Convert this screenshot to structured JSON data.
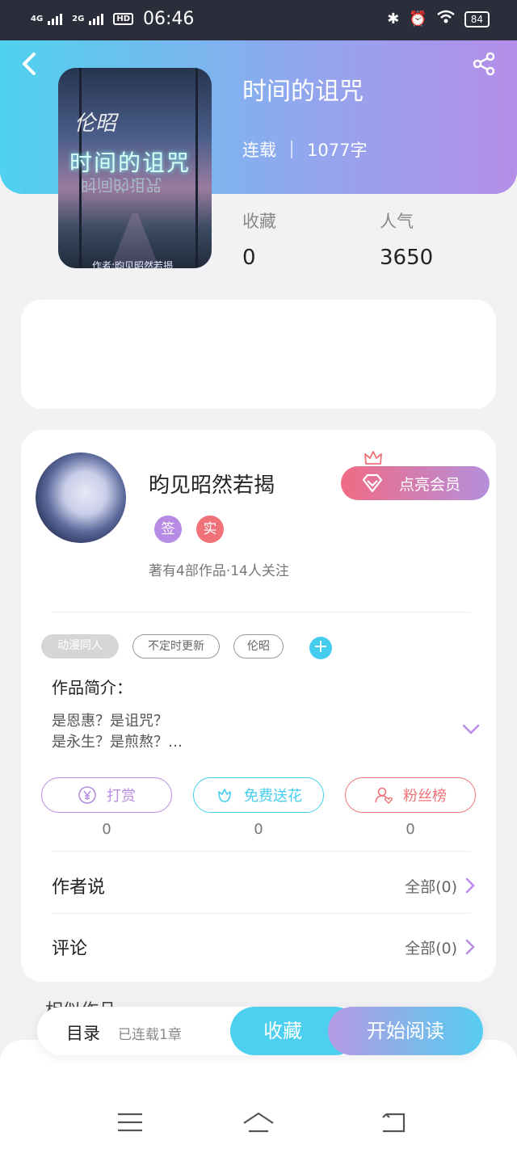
{
  "status_bar": {
    "net1": "4G",
    "net2": "2G",
    "hd": "HD",
    "time": "06:46",
    "battery": "84"
  },
  "book": {
    "title": "时间的诅咒",
    "status": "连载",
    "word_count": "1077字",
    "cover": {
      "top_text": "伦昭",
      "title_text": "时间的诅咒",
      "author_text": "作者:昀见昭然若揭"
    },
    "stats": [
      {
        "label": "收藏",
        "value": "0"
      },
      {
        "label": "人气",
        "value": "3650"
      }
    ]
  },
  "author": {
    "name": "昀见昭然若揭",
    "badges": [
      {
        "label": "签",
        "color": "#b78be3"
      },
      {
        "label": "实",
        "color": "#f07178"
      }
    ],
    "stats": "著有4部作品·14人关注",
    "vip_button": "点亮会员"
  },
  "tags": [
    "动漫同人",
    "不定时更新",
    "伦昭"
  ],
  "tag_add": "+",
  "intro": {
    "label": "作品简介：",
    "line1": "是恩惠？是诅咒？",
    "line2": "是永生？是煎熬？…"
  },
  "actions": [
    {
      "label": "打赏",
      "count": "0",
      "color": "#b78be3",
      "icon": "yen-coin-icon"
    },
    {
      "label": "免费送花",
      "count": "0",
      "color": "#45cdf0",
      "icon": "flower-icon"
    },
    {
      "label": "粉丝榜",
      "count": "0",
      "color": "#f07178",
      "icon": "fan-ranking-icon"
    }
  ],
  "sections": [
    {
      "label": "作者说",
      "link": "全部(0)"
    },
    {
      "label": "评论",
      "link": "全部(0)"
    }
  ],
  "similar_label": "相似作品",
  "bottom_bar": {
    "toc": "目录",
    "chapters": "已连载1章",
    "favorite": "收藏",
    "read": "开始阅读"
  },
  "colors": {
    "accent_cyan": "#4dd0ef",
    "accent_purple": "#b59ae4",
    "accent_pink": "#f07178"
  }
}
